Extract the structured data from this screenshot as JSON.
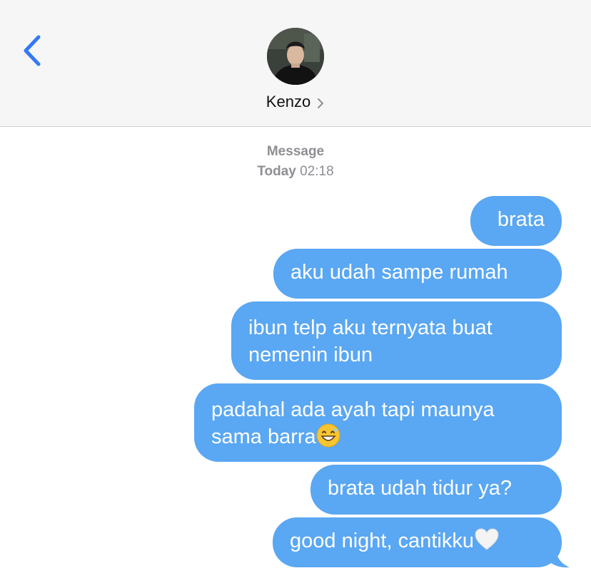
{
  "nav": {
    "back_icon": "chevron-left-icon",
    "contact_name": "Kenzo",
    "chevron_icon": "chevron-right-icon",
    "avatar": "contact-photo"
  },
  "thread": {
    "service_label": "Message",
    "date_label": "Today",
    "time_label": "02:18"
  },
  "messages": [
    {
      "lines": [
        "brata"
      ]
    },
    {
      "lines": [
        "aku udah sampe rumah"
      ]
    },
    {
      "lines": [
        "ibun telp aku ternyata buat",
        "nemenin ibun"
      ]
    },
    {
      "lines": [
        "padahal ada ayah tapi maunya",
        "sama barra"
      ],
      "emoji": "grinning-sweat-emoji"
    },
    {
      "lines": [
        "brata udah tidur ya?"
      ]
    },
    {
      "lines": [
        "good night, cantikku"
      ],
      "emoji": "white-heart-emoji"
    }
  ],
  "colors": {
    "accent": "#3478f6",
    "bubble": "#5aa7f3",
    "header_bg": "#f6f6f6",
    "meta_text": "#8e8e93"
  }
}
